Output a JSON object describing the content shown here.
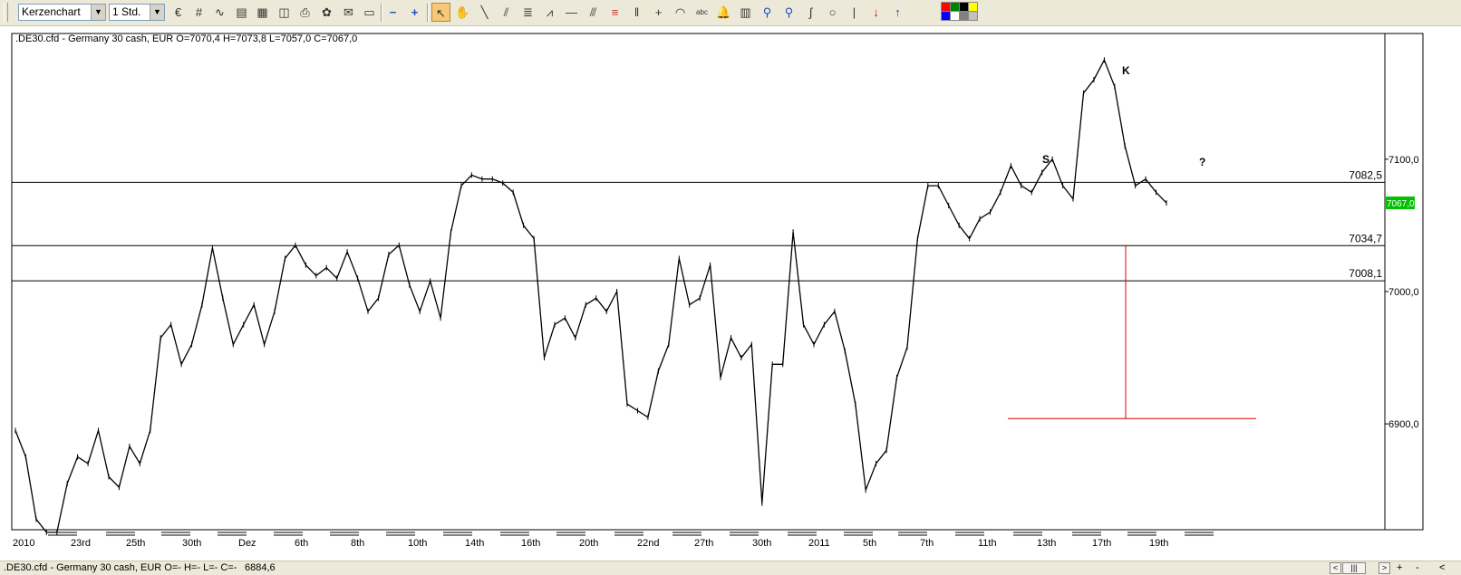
{
  "toolbar": {
    "chart_type": "Kerzenchart",
    "timeframe": "1 Std.",
    "icons": [
      "currency-convert",
      "grid",
      "indicator-chart",
      "properties",
      "image-export",
      "duplicate",
      "print",
      "color-settings",
      "alerts",
      "zoom-out",
      "zoom-in",
      "cursor",
      "hand",
      "line",
      "parallel",
      "channel",
      "fibonacci",
      "horizontal-line",
      "gann-fan",
      "fib-retracement",
      "fib-timezones",
      "crosshair",
      "arc",
      "text",
      "bell",
      "calculator",
      "magnifier",
      "magnifier-plus",
      "wave",
      "ellipse",
      "vertical-line",
      "sell-arrow",
      "buy-arrow",
      "color-swatches"
    ],
    "text_tool_label": "abc",
    "swatch_colors": [
      "#ff0000",
      "#008000",
      "#000000",
      "#ffff00",
      "#0000ff",
      "#ffffff",
      "#808080",
      "#c0c0c0"
    ]
  },
  "chart": {
    "info": ".DE30.cfd - Germany 30 cash, EUR O=7070,4 H=7073,8 L=7057,0 C=7067,0",
    "annotations": [
      "K",
      "S",
      "?"
    ],
    "current_price": "7067,0",
    "up_color": "#000000",
    "marker_color": "#dd0000",
    "current_bg": "#00c000"
  },
  "chart_data": {
    "type": "line",
    "title": ".DE30.cfd - Germany 30 cash, EUR",
    "x_tick_labels": [
      "2010",
      "23rd",
      "25th",
      "30th",
      "Dez",
      "6th",
      "8th",
      "10th",
      "14th",
      "16th",
      "20th",
      "22nd",
      "27th",
      "30th",
      "2011",
      "5th",
      "7th",
      "11th",
      "13th",
      "17th",
      "19th"
    ],
    "y_tick_labels": [
      "7100,0",
      "7000,0",
      "6900,0"
    ],
    "ylim": [
      6820,
      7195
    ],
    "horizontal_levels": [
      {
        "label": "7082,5",
        "value": 7082.5
      },
      {
        "label": "7034,7",
        "value": 7034.7
      },
      {
        "label": "7008,1",
        "value": 7008.1
      }
    ],
    "series": [
      {
        "values": [
          6895,
          6875,
          6828,
          6818,
          6818,
          6855,
          6875,
          6870,
          6895,
          6860,
          6852,
          6883,
          6870,
          6895,
          6965,
          6975,
          6945,
          6960,
          6990,
          7033,
          6995,
          6960,
          6975,
          6990,
          6960,
          6985,
          7025,
          7035,
          7020,
          7012,
          7018,
          7010,
          7030,
          7010,
          6985,
          6995,
          7028,
          7035,
          7005,
          6985,
          7008,
          6980,
          7045,
          7080,
          7088,
          7085,
          7085,
          7082,
          7075,
          7050,
          7040,
          6950,
          6975,
          6980,
          6965,
          6990,
          6995,
          6985,
          7000,
          6915,
          6910,
          6905,
          6940,
          6960,
          7025,
          6990,
          6995,
          7020,
          6935,
          6965,
          6950,
          6960,
          6840,
          6945,
          6945,
          7045,
          6975,
          6960,
          6975,
          6985,
          6955,
          6915,
          6850,
          6870,
          6880,
          6935,
          6958,
          7040,
          7080,
          7080,
          7065,
          7050,
          7040,
          7055,
          7060,
          7075,
          7095,
          7080,
          7075,
          7090,
          7100,
          7080,
          7070,
          7150,
          7160,
          7175,
          7155,
          7110,
          7080,
          7085,
          7075,
          7067
        ]
      }
    ],
    "marker_line": {
      "vertical": "7034,7 to 6904",
      "horizontal_level": 6904
    }
  },
  "statusbar": {
    "text": ".DE30.cfd - Germany 30 cash, EUR O=- H=- L=- C=-",
    "cursor_value": "6884,6",
    "nav": [
      "<",
      "|||",
      ">",
      "+",
      "-",
      "<"
    ]
  }
}
